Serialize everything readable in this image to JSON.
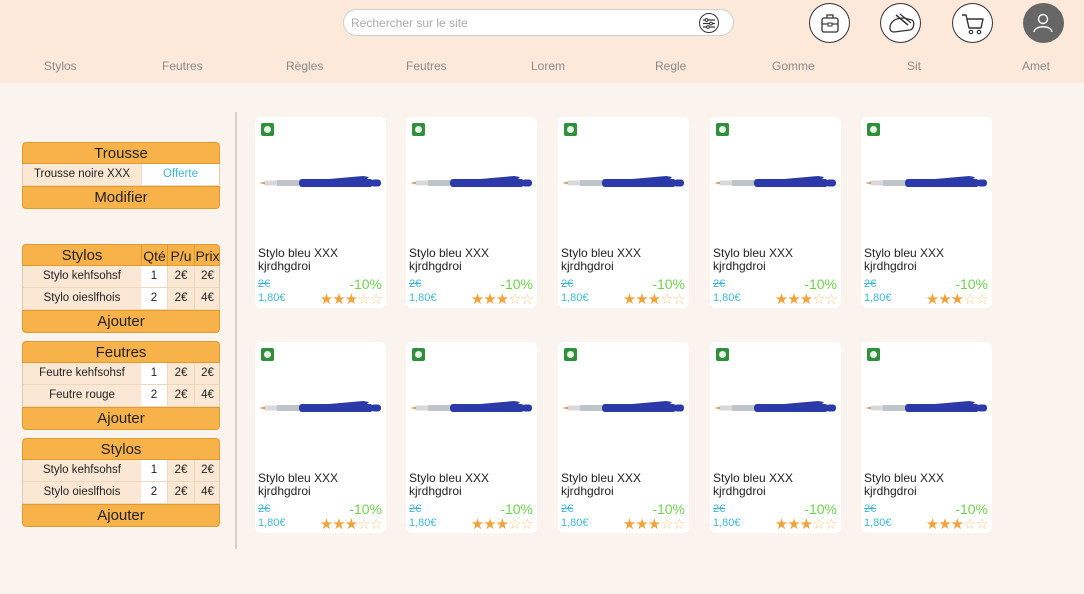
{
  "search": {
    "placeholder": "Rechercher sur le site",
    "filter_icon": "sliders-icon"
  },
  "header_icons": [
    "backpack-icon",
    "pencil-case-icon",
    "cart-icon",
    "account-icon"
  ],
  "nav": [
    "Stylos",
    "Feutres",
    "Règles",
    "Feutres",
    "Lorem",
    "Regle",
    "Gomme",
    "Sit",
    "Amet"
  ],
  "trousse": {
    "title": "Trousse",
    "item": "Trousse noire XXX",
    "price": "Offerte",
    "button": "Modifier"
  },
  "panels": [
    {
      "title": "Stylos",
      "qty_label": "Qté",
      "pu_label": "P/u",
      "price_label": "Prix",
      "rows": [
        {
          "name": "Stylo kehfsohsf",
          "qty": "1",
          "pu": "2€",
          "price": "2€"
        },
        {
          "name": "Stylo oieslfhois",
          "qty": "2",
          "pu": "2€",
          "price": "4€"
        }
      ],
      "button": "Ajouter"
    },
    {
      "title": "Feutres",
      "rows": [
        {
          "name": "Feutre kehfsohsf",
          "qty": "1",
          "pu": "2€",
          "price": "2€"
        },
        {
          "name": "Feutre rouge",
          "qty": "2",
          "pu": "2€",
          "price": "4€"
        }
      ],
      "button": "Ajouter"
    },
    {
      "title": "Stylos",
      "rows": [
        {
          "name": "Stylo kehfsohsf",
          "qty": "1",
          "pu": "2€",
          "price": "2€"
        },
        {
          "name": "Stylo oieslfhois",
          "qty": "2",
          "pu": "2€",
          "price": "4€"
        }
      ],
      "button": "Ajouter"
    }
  ],
  "products": [
    {
      "line1": "Stylo bleu XXX",
      "line2": "kjrdhgdroi",
      "old_price": "2€",
      "new_price": "1,80€",
      "discount": "-10%",
      "rating": 2.5
    },
    {
      "line1": "Stylo bleu XXX",
      "line2": "kjrdhgdroi",
      "old_price": "2€",
      "new_price": "1,80€",
      "discount": "-10%",
      "rating": 2.5
    },
    {
      "line1": "Stylo bleu XXX",
      "line2": "kjrdhgdroi",
      "old_price": "2€",
      "new_price": "1,80€",
      "discount": "-10%",
      "rating": 2.5
    },
    {
      "line1": "Stylo bleu XXX",
      "line2": "kjrdhgdroi",
      "old_price": "2€",
      "new_price": "1,80€",
      "discount": "-10%",
      "rating": 2.5
    },
    {
      "line1": "Stylo bleu XXX",
      "line2": "kjrdhgdroi",
      "old_price": "2€",
      "new_price": "1,80€",
      "discount": "-10%",
      "rating": 2.5
    },
    {
      "line1": "Stylo bleu XXX",
      "line2": "kjrdhgdroi",
      "old_price": "2€",
      "new_price": "1,80€",
      "discount": "-10%",
      "rating": 2.5
    },
    {
      "line1": "Stylo bleu XXX",
      "line2": "kjrdhgdroi",
      "old_price": "2€",
      "new_price": "1,80€",
      "discount": "-10%",
      "rating": 2.5
    },
    {
      "line1": "Stylo bleu XXX",
      "line2": "kjrdhgdroi",
      "old_price": "2€",
      "new_price": "1,80€",
      "discount": "-10%",
      "rating": 2.5
    },
    {
      "line1": "Stylo bleu XXX",
      "line2": "kjrdhgdroi",
      "old_price": "2€",
      "new_price": "1,80€",
      "discount": "-10%",
      "rating": 2.5
    },
    {
      "line1": "Stylo bleu XXX",
      "line2": "kjrdhgdroi",
      "old_price": "2€",
      "new_price": "1,80€",
      "discount": "-10%",
      "rating": 2.5
    }
  ],
  "colors": {
    "header_bg": "#fde9d9",
    "accent": "#f7b24a",
    "price": "#3fb8d8",
    "discount": "#6fd34f",
    "star": "#f2a23a",
    "pen": "#2b3aa8"
  }
}
